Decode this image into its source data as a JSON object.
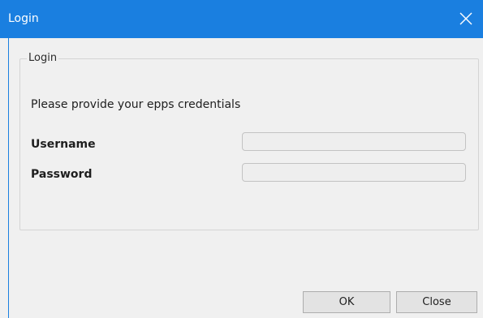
{
  "window": {
    "title": "Login",
    "close_icon": "close-icon",
    "title_bar_color": "#1a7fe0"
  },
  "group": {
    "legend": "Login",
    "prompt": "Please provide your epps credentials",
    "username_label": "Username",
    "username_value": "",
    "password_label": "Password",
    "password_value": ""
  },
  "buttons": {
    "ok_label": "OK",
    "close_label": "Close"
  }
}
